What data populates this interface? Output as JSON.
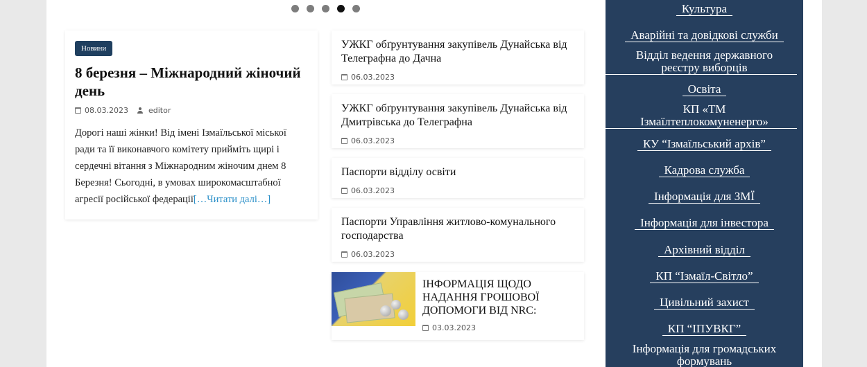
{
  "slider": {
    "dots": 5,
    "active": 4
  },
  "featured": {
    "category": "Новини",
    "title": "8 березня – Міжнародний жіночий день",
    "date": "08.03.2023",
    "author": "editor",
    "excerpt": "Дорогі наші жінки! Від імені Ізмаїльської міської ради  та її виконавчого комітету прийміть  щирі і сердечні вітання з Міжнародним жіночим днем 8 Березня! Сьогодні, в умовах широкомасштабної агресії російської федерації",
    "read_more": "[…Читати далі…]"
  },
  "posts": [
    {
      "title": "УЖКГ обґрунтування закупівель Дунайська від Телеграфна до Дачна",
      "date": "06.03.2023"
    },
    {
      "title": "УЖКГ обґрунтування закупівель Дунайська від Дмитрівська до Телеграфна",
      "date": "06.03.2023"
    },
    {
      "title": "Паспорти відділу освіти",
      "date": "06.03.2023"
    },
    {
      "title": "Паспорти Управління житлово-комунального господарства",
      "date": "06.03.2023"
    }
  ],
  "thumb_post": {
    "title": "ІНФОРМАЦІЯ ЩОДО НАДАННЯ ГРОШОВОЇ ДОПОМОГИ ВІД NRC:",
    "date": "03.03.2023"
  },
  "sidebar": {
    "culture": "Культура",
    "emergency": "Аварійні та довідкові служби",
    "registry": "Відділ ведення державного реєстру виборців",
    "education": "Освіта",
    "heating": "КП «ТМ Ізмаїлтеплокомуненерго»",
    "archive_ku": "КУ “Ізмаїльський архів”",
    "hr": "Кадрова служба",
    "media": "Інформація для ЗМЇ",
    "investor": "Інформація для інвестора",
    "archive_dept": "Архівний відділ",
    "light": "КП “Ізмаїл-Світло”",
    "civil": "Цивільний захист",
    "water": "КП “ІПУВКГ”",
    "public": "Інформація для громадських формувань"
  },
  "colors": {
    "sidebar_bg": "#263f5e",
    "badge_bg": "#1f3f5f",
    "link": "#2a8fc8"
  }
}
